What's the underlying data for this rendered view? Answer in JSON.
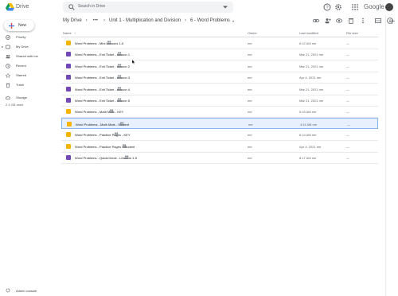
{
  "app": {
    "brand": "Drive"
  },
  "search": {
    "placeholder": "Search in Drive"
  },
  "header": {
    "google_wordmark": "Google"
  },
  "sidebar": {
    "new_label": "New",
    "items": [
      {
        "label": "Priority",
        "icon": "check-circle-icon"
      },
      {
        "label": "My Drive",
        "icon": "my-drive-icon"
      },
      {
        "label": "Shared with me",
        "icon": "people-icon"
      },
      {
        "label": "Recent",
        "icon": "clock-icon"
      },
      {
        "label": "Starred",
        "icon": "star-icon"
      },
      {
        "label": "Trash",
        "icon": "trash-icon"
      },
      {
        "label": "Storage",
        "icon": "cloud-icon"
      }
    ],
    "storage_used": "2.4 GB used",
    "admin_label": "Admin console"
  },
  "breadcrumb": {
    "root": "My Drive",
    "more": "•••",
    "parent": "Unit 1 - Multiplication and Division",
    "current": "6 - Word Problems"
  },
  "list": {
    "headers": {
      "name": "Name",
      "sort_arrow": "↑",
      "owner": "Owner",
      "modified": "Last modified",
      "size": "File size"
    },
    "rows": [
      {
        "name": "Word Problems - Mini Lessons 1-5",
        "type": "slides",
        "owner": "me",
        "modified": "6:12 AM me",
        "size": "—"
      },
      {
        "name": "Word Problems - Exit Ticket - Lesson 1",
        "type": "forms",
        "owner": "me",
        "modified": "Mar 21, 2021 me",
        "size": "—"
      },
      {
        "name": "Word Problems - Exit Ticket - Lesson 2",
        "type": "forms",
        "owner": "me",
        "modified": "Mar 21, 2021 me",
        "size": "—"
      },
      {
        "name": "Word Problems - Exit Ticket - Lesson 3",
        "type": "forms",
        "owner": "me",
        "modified": "Apr 4, 2021 me",
        "size": "—"
      },
      {
        "name": "Word Problems - Exit Ticket - Lesson 4",
        "type": "forms",
        "owner": "me",
        "modified": "Mar 21, 2021 me",
        "size": "—"
      },
      {
        "name": "Word Problems - Exit Ticket - Lesson 5",
        "type": "forms",
        "owner": "me",
        "modified": "Mar 21, 2021 me",
        "size": "—"
      },
      {
        "name": "Word Problems - Math Mats - KEY",
        "type": "slides",
        "owner": "me",
        "modified": "5:15 AM me",
        "size": "—"
      },
      {
        "name": "Word Problems - Math Mats - Student",
        "type": "slides",
        "owner": "me",
        "modified": "4:11 AM me",
        "size": "—",
        "selected": true
      },
      {
        "name": "Word Problems - Practice Pages - KEY",
        "type": "slides",
        "owner": "me",
        "modified": "6:14 AM me",
        "size": "—"
      },
      {
        "name": "Word Problems - Practice Pages - Student",
        "type": "slides",
        "owner": "me",
        "modified": "Apr 4, 2021 me",
        "size": "—"
      },
      {
        "name": "Word Problems - QuickCheck - Lessons 1-5",
        "type": "forms",
        "owner": "me",
        "modified": "6:17 AM me",
        "size": "—"
      }
    ]
  },
  "colors": {
    "accent": "#1a73e8",
    "selected_bg": "#e8f0fe",
    "slides": "#f4b400",
    "forms": "#7248b9"
  }
}
